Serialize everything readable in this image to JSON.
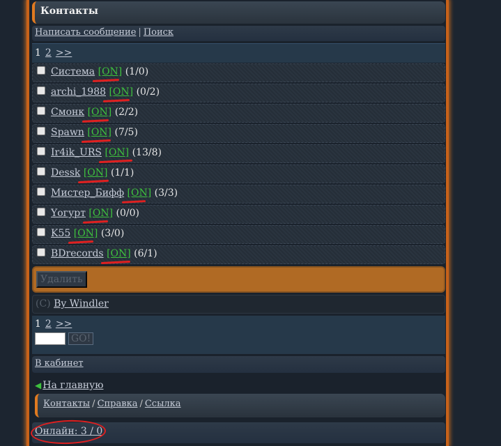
{
  "header": {
    "title": "Контакты"
  },
  "menu": {
    "write": "Написать сообщение",
    "sep": "|",
    "search": "Поиск"
  },
  "pager": {
    "current": "1",
    "next_page": "2",
    "forward": ">>"
  },
  "contacts": [
    {
      "name": "Система",
      "status": "[ON]",
      "counts": "(1/0)"
    },
    {
      "name": "archi_1988",
      "status": "[ON]",
      "counts": "(0/2)"
    },
    {
      "name": "Смонк",
      "status": "[ON]",
      "counts": "(2/2)"
    },
    {
      "name": "Spawn",
      "status": "[ON]",
      "counts": "(7/5)"
    },
    {
      "name": "Ir4ik_URS",
      "status": "[ON]",
      "counts": "(13/8)"
    },
    {
      "name": "Dessk",
      "status": "[ON]",
      "counts": "(1/1)"
    },
    {
      "name": "Мистер_Бифф",
      "status": "[ON]",
      "counts": "(3/3)"
    },
    {
      "name": "Yогурт",
      "status": "[ON]",
      "counts": "(0/0)"
    },
    {
      "name": "K55",
      "status": "[ON]",
      "counts": "(3/0)"
    },
    {
      "name": "BDrecords",
      "status": "[ON]",
      "counts": "(6/1)"
    }
  ],
  "actions": {
    "delete_label": "Удалить"
  },
  "credit": {
    "copyright": "(C)",
    "author": "By Windler"
  },
  "pager2": {
    "current": "1",
    "next_page": "2",
    "forward": ">>",
    "go_label": "GO!"
  },
  "cabinet": {
    "label": "В кабинет"
  },
  "home": {
    "label": "На главную",
    "icon": "arrow-left-icon"
  },
  "footer": {
    "contacts": "Контакты",
    "help": "Справка",
    "link": "Ссылка",
    "sep": "/"
  },
  "online": {
    "label": "Онлайн: 3 / 0"
  },
  "colors": {
    "accent": "#e07a20",
    "status_on": "#3ec13e",
    "annotation": "#e02020",
    "delete_bar": "#b06a24"
  }
}
